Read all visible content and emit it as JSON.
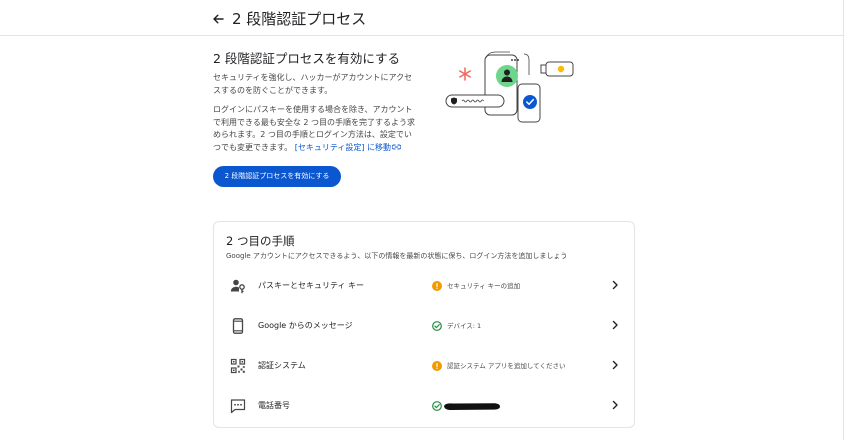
{
  "header": {
    "title": "2 段階認証プロセス"
  },
  "intro": {
    "title": "2 段階認証プロセスを有効にする",
    "paragraph1": "セキュリティを強化し、ハッカーがアカウントにアクセスするのを防ぐことができます。",
    "paragraph2": "ログインにパスキーを使用する場合を除き、アカウントで利用できる最も安全な 2 つ目の手順を完了するよう求められます。2 つ目の手順とログイン方法は、設定でいつでも変更できます。",
    "link": "[セキュリティ設定] に移動",
    "button": "2 段階認証プロセスを有効にする"
  },
  "second_steps": {
    "title": "2 つ目の手順",
    "subtitle": "Google アカウントにアクセスできるよう、以下の情報を最新の状態に保ち、ログイン方法を追加しましょう",
    "rows": [
      {
        "name": "パスキーとセキュリティ キー",
        "status": "セキュリティ キーの追加",
        "status_type": "warning"
      },
      {
        "name": "Google からのメッセージ",
        "status": "デバイス: 1",
        "status_type": "ok"
      },
      {
        "name": "認証システム",
        "status": "認証システム アプリを追加してください",
        "status_type": "warning"
      },
      {
        "name": "電話番号",
        "status": "",
        "status_type": "ok-redacted"
      }
    ]
  },
  "colors": {
    "accent": "#0b57d0",
    "warning": "#f29900",
    "ok": "#1e8e3e"
  }
}
